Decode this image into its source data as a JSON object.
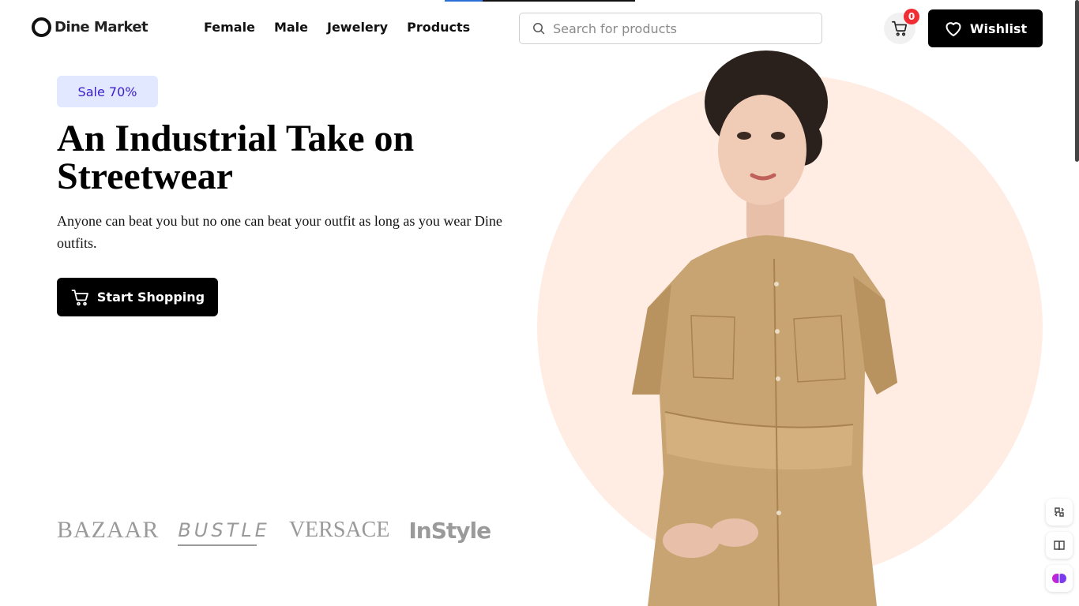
{
  "brand": {
    "name": "Dine Market"
  },
  "nav": {
    "items": [
      {
        "label": "Female"
      },
      {
        "label": "Male"
      },
      {
        "label": "Jewelery"
      },
      {
        "label": "Products"
      }
    ]
  },
  "search": {
    "placeholder": "Search for products",
    "value": ""
  },
  "cart": {
    "count": "0"
  },
  "wishlist": {
    "label": "Wishlist"
  },
  "hero": {
    "badge": "Sale 70%",
    "title": "An Industrial Take on Streetwear",
    "description": "Anyone can beat you but no one can beat your outfit as long as you wear Dine outfits.",
    "cta_label": "Start Shopping"
  },
  "brands": [
    {
      "name": "BAZAAR"
    },
    {
      "name": "BUSTLE"
    },
    {
      "name": "VERSACE"
    },
    {
      "name": "InStyle"
    }
  ],
  "icons": {
    "search": "search-icon",
    "cart": "cart-icon",
    "wishlist": "heart-icon",
    "cta": "cart-icon",
    "side_tools": [
      "translate-icon",
      "book-icon",
      "brain-icon"
    ]
  },
  "colors": {
    "accent": "#000000",
    "badge_bg": "#e1e8ff",
    "badge_text": "#3b1ccd",
    "circle_bg": "#ffece3",
    "cart_badge": "#f02d34"
  }
}
